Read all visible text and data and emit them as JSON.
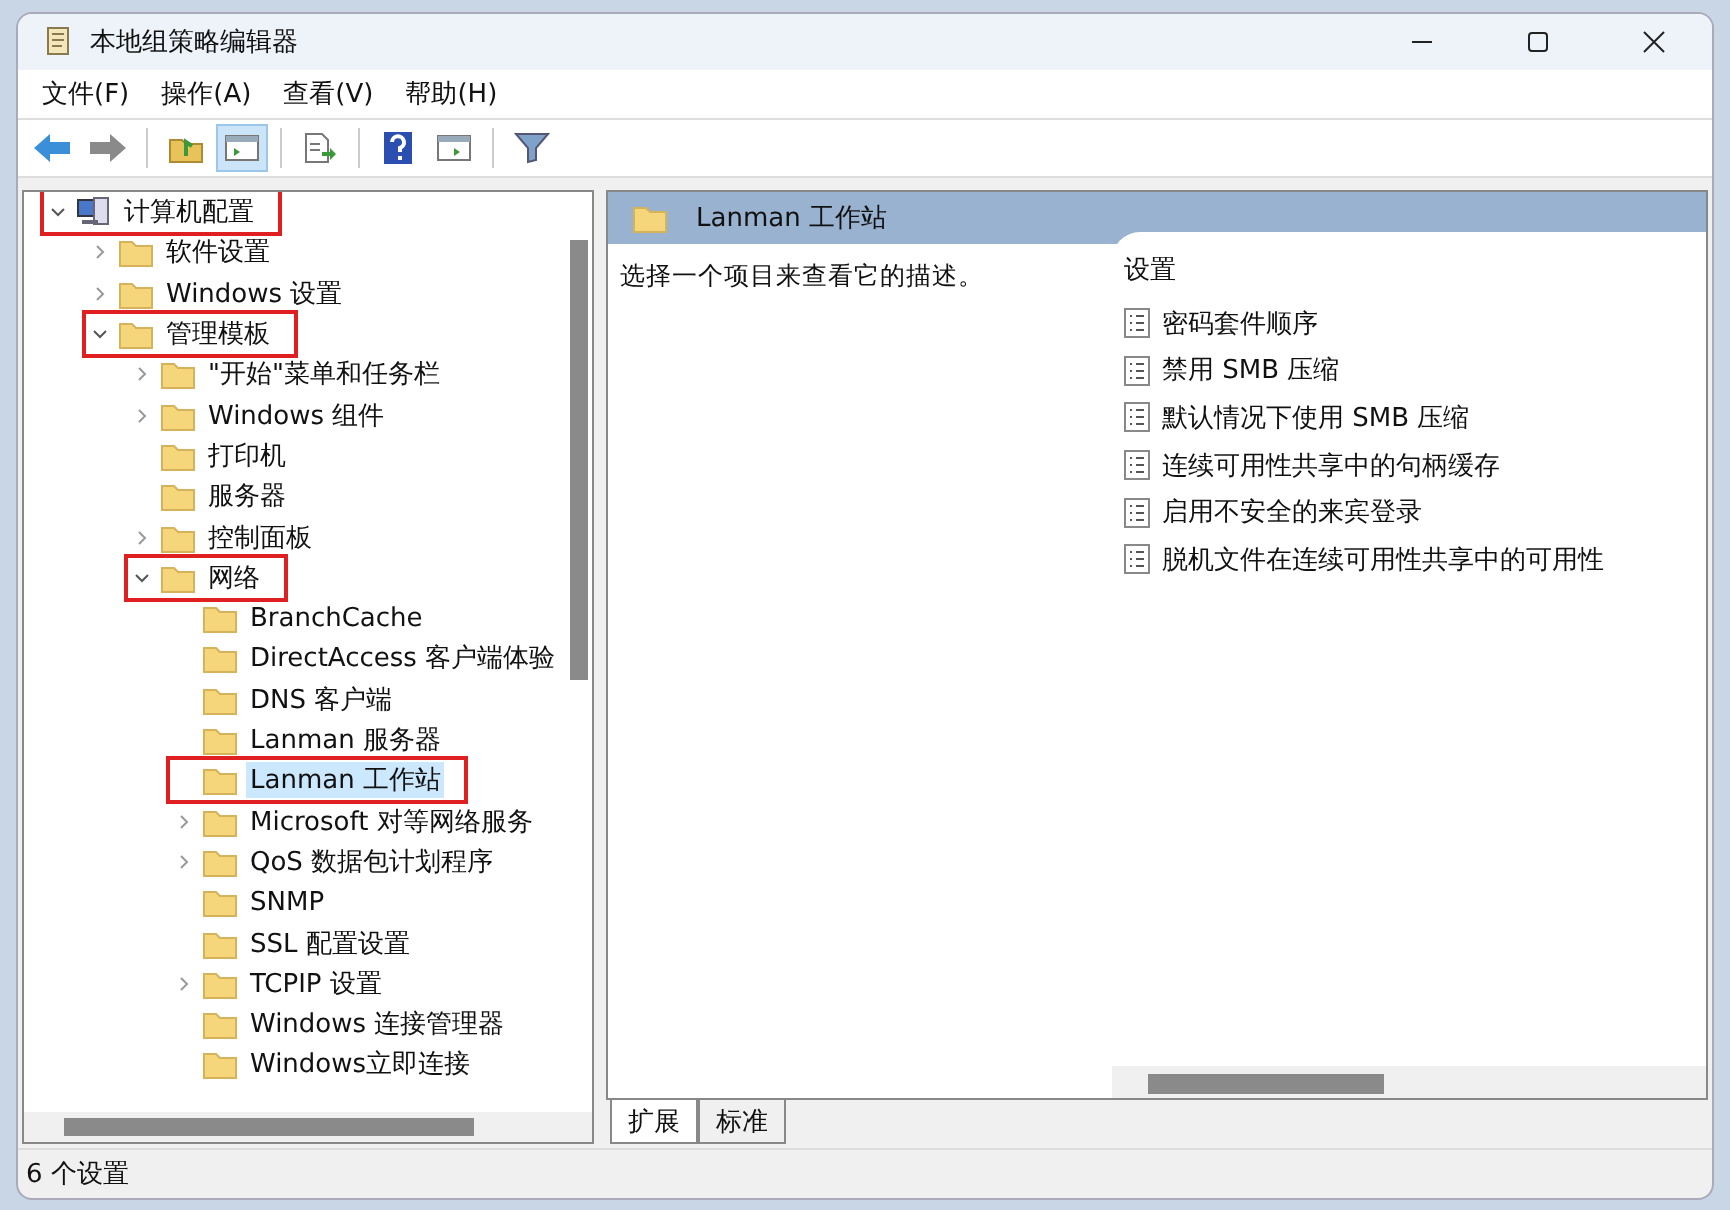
{
  "window": {
    "title": "本地组策略编辑器"
  },
  "menu": [
    "文件(F)",
    "操作(A)",
    "查看(V)",
    "帮助(H)"
  ],
  "toolbar": [
    {
      "kind": "back",
      "selected": false
    },
    {
      "kind": "forward",
      "selected": false
    },
    {
      "kind": "sep"
    },
    {
      "kind": "up",
      "selected": false
    },
    {
      "kind": "tree",
      "selected": true
    },
    {
      "kind": "sep"
    },
    {
      "kind": "export",
      "selected": false
    },
    {
      "kind": "sep"
    },
    {
      "kind": "help",
      "selected": false
    },
    {
      "kind": "console",
      "selected": false
    },
    {
      "kind": "sep"
    },
    {
      "kind": "filter",
      "selected": false
    }
  ],
  "tree": [
    {
      "label": "计算机配置",
      "kind": "computer",
      "expanded": true,
      "selected": false,
      "highlighted": true,
      "children": [
        {
          "label": "软件设置",
          "expanded": false,
          "selected": false,
          "highlighted": false
        },
        {
          "label": "Windows 设置",
          "expanded": false,
          "selected": false,
          "highlighted": false
        },
        {
          "label": "管理模板",
          "expanded": true,
          "selected": false,
          "highlighted": true,
          "children": [
            {
              "label": "\"开始\"菜单和任务栏",
              "expanded": false,
              "selected": false,
              "highlighted": false
            },
            {
              "label": "Windows 组件",
              "expanded": false,
              "selected": false,
              "highlighted": false
            },
            {
              "label": "打印机",
              "selected": false,
              "highlighted": false
            },
            {
              "label": "服务器",
              "selected": false,
              "highlighted": false
            },
            {
              "label": "控制面板",
              "expanded": false,
              "selected": false,
              "highlighted": false
            },
            {
              "label": "网络",
              "expanded": true,
              "selected": false,
              "highlighted": true,
              "children": [
                {
                  "label": "BranchCache",
                  "selected": false,
                  "highlighted": false
                },
                {
                  "label": "DirectAccess 客户端体验",
                  "selected": false,
                  "highlighted": false
                },
                {
                  "label": "DNS 客户端",
                  "selected": false,
                  "highlighted": false
                },
                {
                  "label": "Lanman 服务器",
                  "selected": false,
                  "highlighted": false
                },
                {
                  "label": "Lanman 工作站",
                  "selected": true,
                  "highlighted": true
                },
                {
                  "label": "Microsoft 对等网络服务",
                  "expanded": false,
                  "selected": false,
                  "highlighted": false
                },
                {
                  "label": "QoS 数据包计划程序",
                  "expanded": false,
                  "selected": false,
                  "highlighted": false
                },
                {
                  "label": "SNMP",
                  "selected": false,
                  "highlighted": false
                },
                {
                  "label": "SSL 配置设置",
                  "selected": false,
                  "highlighted": false
                },
                {
                  "label": "TCPIP 设置",
                  "expanded": false,
                  "selected": false,
                  "highlighted": false
                },
                {
                  "label": "Windows 连接管理器",
                  "selected": false,
                  "highlighted": false
                },
                {
                  "label": "Windows立即连接",
                  "selected": false,
                  "highlighted": false
                }
              ]
            }
          ]
        }
      ]
    }
  ],
  "detail": {
    "title": "Lanman 工作站",
    "description": "选择一个项目来查看它的描述。",
    "settings_heading": "设置",
    "settings": [
      "密码套件顺序",
      "禁用 SMB 压缩",
      "默认情况下使用 SMB 压缩",
      "连续可用性共享中的句柄缓存",
      "启用不安全的来宾登录",
      "脱机文件在连续可用性共享中的可用性"
    ]
  },
  "view_tabs": [
    {
      "label": "扩展",
      "selected": true
    },
    {
      "label": "标准",
      "selected": false
    }
  ],
  "status_bar": "6 个设置"
}
